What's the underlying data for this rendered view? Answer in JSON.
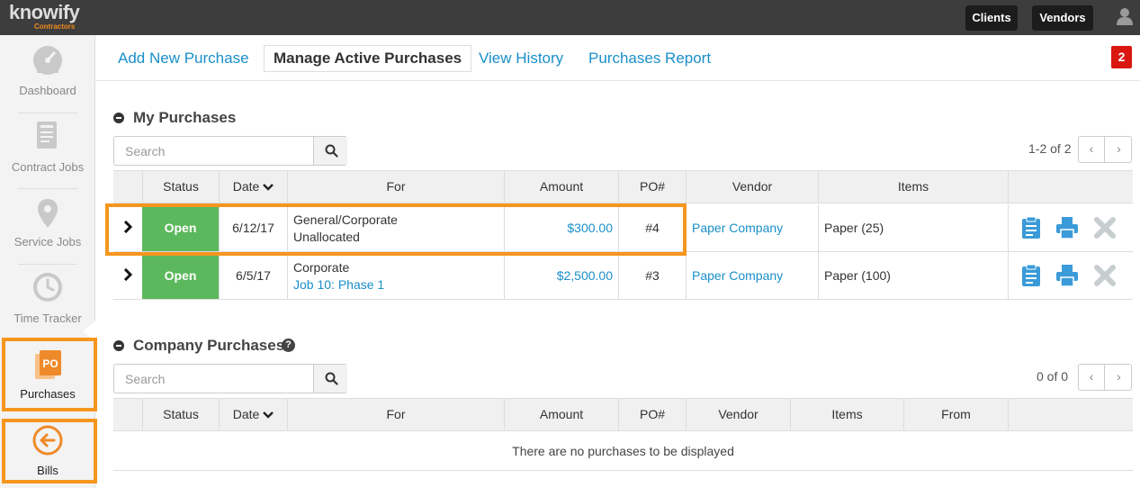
{
  "app": {
    "logo": "knowify",
    "logo_sub": "Contractors"
  },
  "topbar": {
    "clients": "Clients",
    "vendors": "Vendors"
  },
  "sidebar": {
    "items": [
      {
        "label": "Dashboard",
        "icon": "dashboard-icon"
      },
      {
        "label": "Contract Jobs",
        "icon": "contract-jobs-icon"
      },
      {
        "label": "Service Jobs",
        "icon": "map-pin-icon"
      },
      {
        "label": "Time Tracker",
        "icon": "clock-icon"
      },
      {
        "label": "Purchases",
        "icon": "po-icon",
        "icon_text": "PO",
        "active": true
      },
      {
        "label": "Bills",
        "icon": "arrow-left-circle-icon"
      }
    ]
  },
  "nav": {
    "tabs": [
      {
        "label": "Add New Purchase"
      },
      {
        "label": "Manage Active Purchases",
        "active": true
      },
      {
        "label": "View History"
      },
      {
        "label": "Purchases Report"
      }
    ],
    "badge": "2"
  },
  "my_purchases": {
    "title": "My Purchases",
    "search_placeholder": "Search",
    "pager": "1-2 of 2",
    "columns": [
      "Status",
      "Date",
      "For",
      "Amount",
      "PO#",
      "Vendor",
      "Items"
    ],
    "rows": [
      {
        "status": "Open",
        "date": "6/12/17",
        "for_line1": "General/Corporate",
        "for_line2": "Unallocated",
        "amount": "$300.00",
        "po": "#4",
        "vendor": "Paper Company",
        "items": "Paper (25)"
      },
      {
        "status": "Open",
        "date": "6/5/17",
        "for_line1": "Corporate",
        "for_line2": "Job 10: Phase 1",
        "amount": "$2,500.00",
        "po": "#3",
        "vendor": "Paper Company",
        "items": "Paper (100)"
      }
    ]
  },
  "company_purchases": {
    "title": "Company Purchases",
    "help": "?",
    "search_placeholder": "Search",
    "pager": "0 of 0",
    "columns": [
      "Status",
      "Date",
      "For",
      "Amount",
      "PO#",
      "Vendor",
      "Items",
      "From"
    ],
    "empty": "There are no purchases to be displayed"
  },
  "colors": {
    "accent": "#1a8fc9",
    "open_status": "#5cb85c",
    "highlight": "#f5961e",
    "badge": "#d9160f",
    "topbar": "#3d3d3d"
  }
}
